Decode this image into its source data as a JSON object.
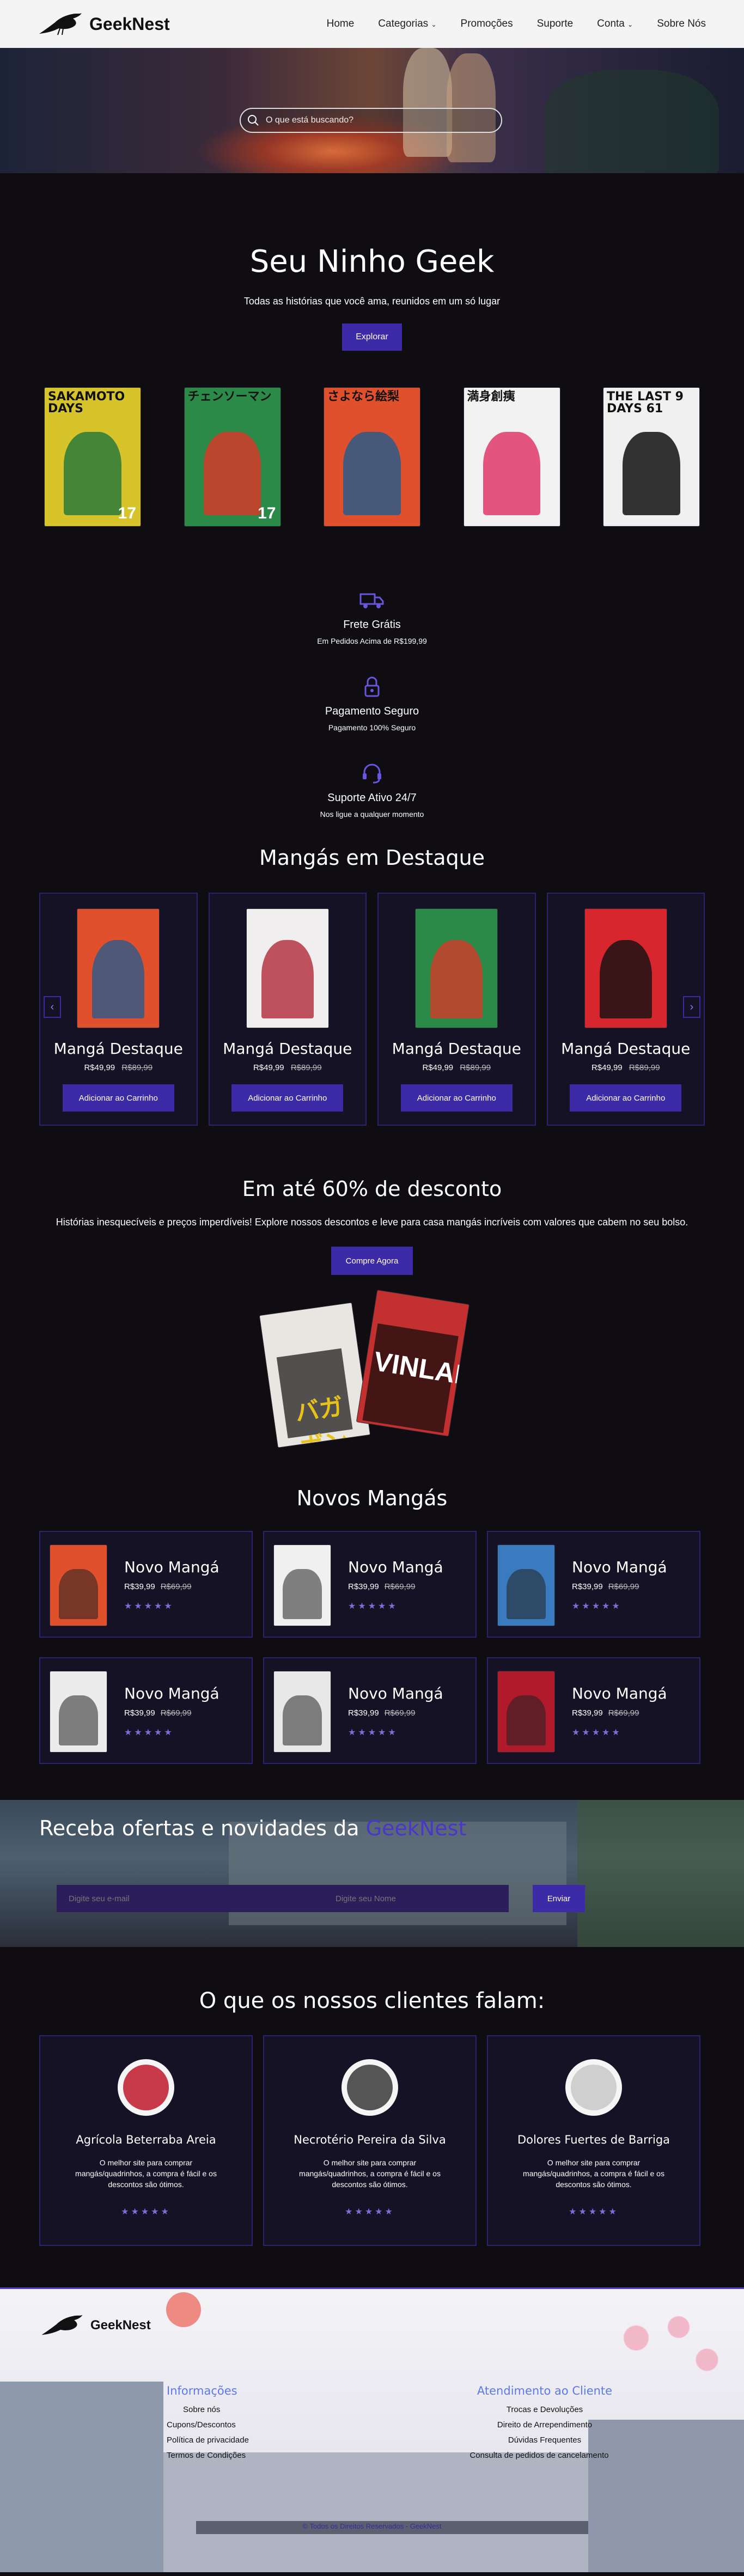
{
  "nav": {
    "brand": "GeekNest",
    "links": [
      "Home",
      "Categorias",
      "Promoções",
      "Suporte",
      "Conta",
      "Sobre Nós"
    ]
  },
  "search": {
    "placeholder": "O que está buscando?"
  },
  "intro": {
    "title": "Seu Ninho Geek",
    "subtitle": "Todas as histórias que você ama, reunidos em um só lugar",
    "button": "Explorar"
  },
  "covers": [
    {
      "title": "SAKAMOTO DAYS",
      "num": "17",
      "bg": "#d7c42a",
      "accent": "#2a7a3a"
    },
    {
      "title": "チェンソーマン",
      "num": "17",
      "bg": "#2c8a48",
      "accent": "#d53a2a"
    },
    {
      "title": "さよなら絵梨",
      "num": "",
      "bg": "#e0502c",
      "accent": "#2a5a8a"
    },
    {
      "title": "満身創痍",
      "num": "",
      "bg": "#f2f2f2",
      "accent": "#e13a6a"
    },
    {
      "title": "THE LAST 9 DAYS 61",
      "num": "",
      "bg": "#f0f0f0",
      "accent": "#111111"
    }
  ],
  "features": [
    {
      "icon": "truck-icon",
      "title": "Frete Grátis",
      "sub": "Em Pedidos Acima de R$199,99"
    },
    {
      "icon": "lock-icon",
      "title": "Pagamento Seguro",
      "sub": "Pagamento 100% Seguro"
    },
    {
      "icon": "headset-icon",
      "title": "Suporte Ativo 24/7",
      "sub": "Nos ligue a qualquer momento"
    }
  ],
  "featured": {
    "title": "Mangás em Destaque",
    "items": [
      {
        "name": "Mangá Destaque",
        "price": "R$49,99",
        "old": "R$89,99",
        "btn": "Adicionar ao Carrinho",
        "bg": "#e0502c",
        "accent": "#2a5a8a"
      },
      {
        "name": "Mangá Destaque",
        "price": "R$49,99",
        "old": "R$89,99",
        "btn": "Adicionar ao Carrinho",
        "bg": "#f0eeee",
        "accent": "#b02a3a"
      },
      {
        "name": "Mangá Destaque",
        "price": "R$49,99",
        "old": "R$89,99",
        "btn": "Adicionar ao Carrinho",
        "bg": "#2c8a48",
        "accent": "#d53a2a"
      },
      {
        "name": "Mangá Destaque",
        "price": "R$49,99",
        "old": "R$89,99",
        "btn": "Adicionar ao Carrinho",
        "bg": "#d8262e",
        "accent": "#111111"
      }
    ]
  },
  "promo": {
    "title": "Em até 60% de desconto",
    "text": "Histórias inesquecíveis e preços imperdíveis! Explore nossos descontos e leve para casa mangás incríveis com valores que cabem no seu bolso.",
    "button": "Compre Agora"
  },
  "new": {
    "title": "Novos Mangás",
    "items": [
      {
        "name": "Novo Mangá",
        "price": "R$39,99",
        "old": "R$69,99",
        "bg": "#e0502c"
      },
      {
        "name": "Novo Mangá",
        "price": "R$39,99",
        "old": "R$69,99",
        "bg": "#f0f0f0"
      },
      {
        "name": "Novo Mangá",
        "price": "R$39,99",
        "old": "R$69,99",
        "bg": "#3a7abf"
      },
      {
        "name": "Novo Mangá",
        "price": "R$39,99",
        "old": "R$69,99",
        "bg": "#ececec"
      },
      {
        "name": "Novo Mangá",
        "price": "R$39,99",
        "old": "R$69,99",
        "bg": "#e8e8e8"
      },
      {
        "name": "Novo Mangá",
        "price": "R$39,99",
        "old": "R$69,99",
        "bg": "#b01a2a"
      }
    ],
    "stars": "★★★★★"
  },
  "newsletter": {
    "title": "Receba ofertas e novidades da ",
    "brand": "GeekNest",
    "email_ph": "Digite seu e-mail",
    "name_ph": "Digite seu Nome",
    "button": "Enviar"
  },
  "testimonials": {
    "title": "O que os nossos clientes falam:",
    "items": [
      {
        "name": "Agrícola Beterraba Areia",
        "text": "O melhor site para comprar mangás/quadrinhos, a compra é fácil e os descontos são ótimos.",
        "avatar": "#c83a4a"
      },
      {
        "name": "Necrotério Pereira da Silva",
        "text": "O melhor site para comprar mangás/quadrinhos, a compra é fácil e os descontos são ótimos.",
        "avatar": "#555555"
      },
      {
        "name": "Dolores Fuertes de Barriga",
        "text": "O melhor site para comprar mangás/quadrinhos, a compra é fácil e os descontos são ótimos.",
        "avatar": "#cfcfcf"
      }
    ],
    "stars": "★★★★★"
  },
  "footer": {
    "brand": "GeekNest",
    "col1": {
      "title": "Informações",
      "links": [
        "Sobre nós",
        "Cupons/Descontos",
        "Política de privacidade",
        "Termos de Condições"
      ]
    },
    "col2": {
      "title": "Atendimento ao Cliente",
      "links": [
        "Trocas e Devoluções",
        "Direito de Arrependimento",
        "Dúvidas Frequentes",
        "Consulta de pedidos de cancelamento"
      ]
    },
    "copyright": "© Todos os Direitos Reservados - GeekNest"
  },
  "colors": {
    "accent": "#3d2aa6",
    "bg": "#0f0d12",
    "card_border": "#2a2470"
  }
}
